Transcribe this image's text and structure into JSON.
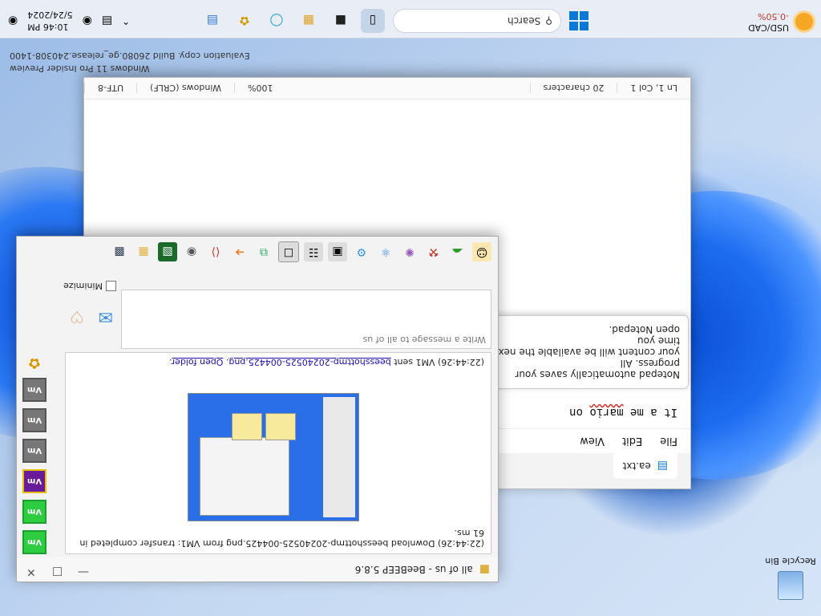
{
  "watermark": {
    "line1": "Evaluation copy. Build 26080.ge_release.240308-1400",
    "line2": "Windows 11 Pro Insider Preview"
  },
  "taskbar": {
    "weather_pair": "USD/CAD",
    "weather_change": "-0.50%",
    "search_placeholder": "Search",
    "time": "10:46 PM",
    "date": "5/24/2024"
  },
  "desktop": {
    "recycle_bin_label": "Recycle Bin"
  },
  "notepad": {
    "tab_title": "ea.txt",
    "menu": [
      "File",
      "Edit",
      "View"
    ],
    "text_before": "It a me ",
    "text_misspelled": "mario",
    "text_after": " on",
    "tip_line1": "Notepad automatically saves your progress. All",
    "tip_line2": "your content will be available the next time you",
    "tip_line3": "open Notepad.",
    "status": {
      "position": "Ln 1, Col 1",
      "chars": "20 characters",
      "zoom": "100%",
      "line_ending": "Windows (CRLF)",
      "encoding": "UTF-8"
    }
  },
  "beebeep": {
    "title": "all of us - BeeBEEP 5.8.6",
    "chat_line1": "(22:44:26) Download beesshottmp-20240525-004425.png from VM1: transfer completed in 61 ms.",
    "chat_line2_prefix": "(22:44:26) VM1 sent ",
    "chat_line2_link": "beesshottmp-20240525-004425.png",
    "chat_line2_sep": ". ",
    "chat_line2_link2": "Open folder",
    "chat_line2_end": ".",
    "input_placeholder": "Write a message to all of us",
    "minimize_label": "Minimize",
    "users": [
      "Vm",
      "Vm",
      "Vm",
      "Vm",
      "Vm",
      "Vm"
    ]
  },
  "colors": {
    "accent": "#0a78d7",
    "vm_green": "#2ecc40",
    "vm_purple": "#6a1b9a",
    "vm_gray": "#777777"
  }
}
